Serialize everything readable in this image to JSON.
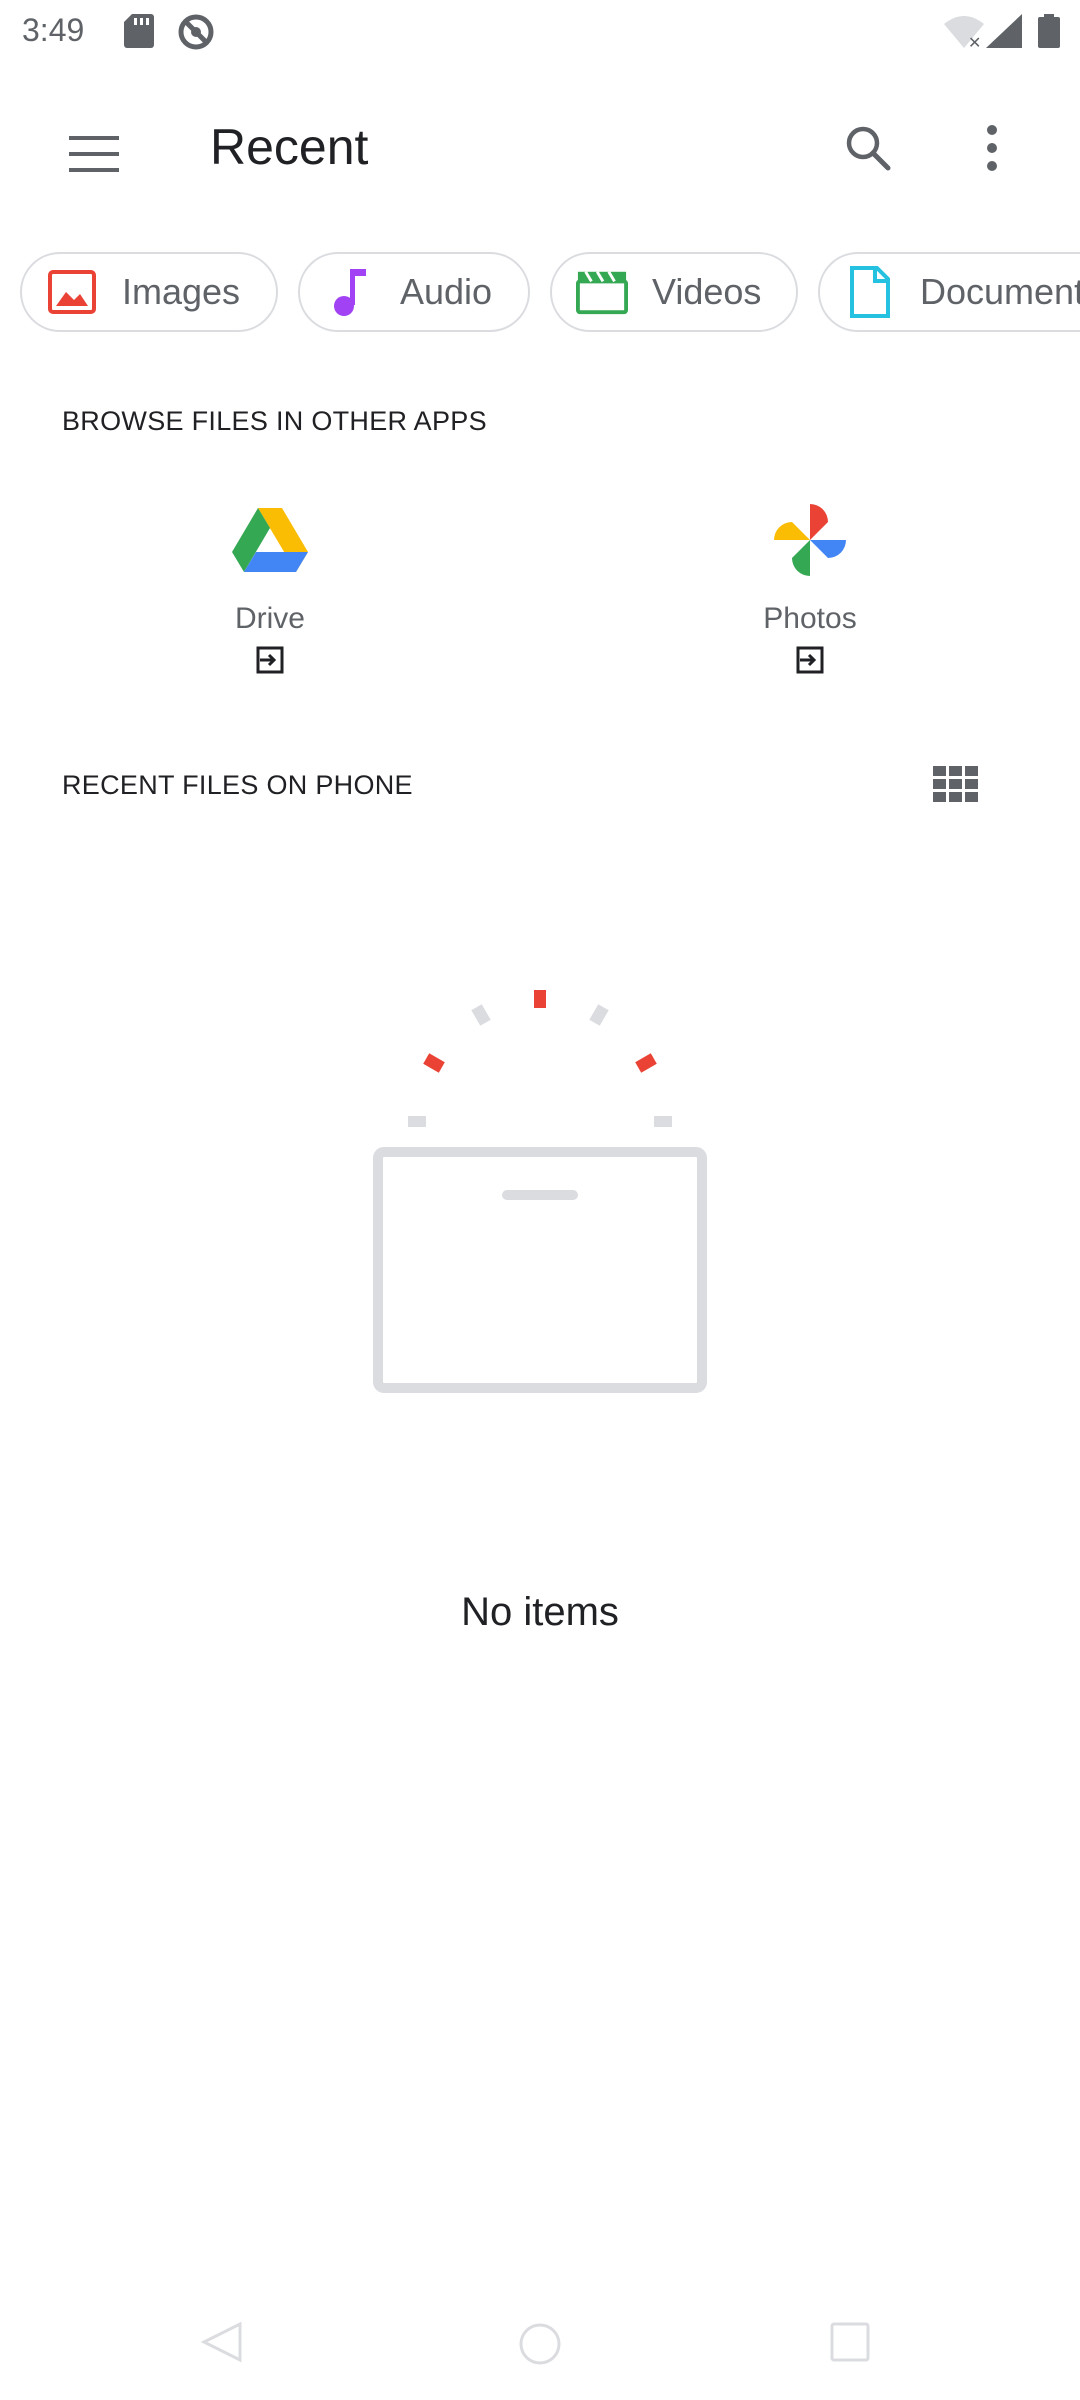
{
  "status_bar": {
    "time": "3:49"
  },
  "app_bar": {
    "title": "Recent"
  },
  "chips": [
    {
      "label": "Images",
      "icon": "image-icon",
      "color": "#ea4335"
    },
    {
      "label": "Audio",
      "icon": "music-note-icon",
      "color": "#a142f4"
    },
    {
      "label": "Videos",
      "icon": "film-clapper-icon",
      "color": "#34a853"
    },
    {
      "label": "Documents",
      "icon": "document-icon",
      "color": "#24c1e0"
    }
  ],
  "browse_section": {
    "header": "BROWSE FILES IN OTHER APPS",
    "apps": [
      {
        "name": "Drive",
        "icon": "google-drive-logo"
      },
      {
        "name": "Photos",
        "icon": "google-photos-logo"
      }
    ]
  },
  "recent_section": {
    "header": "RECENT FILES ON PHONE",
    "view_toggle_icon": "grid-view-icon"
  },
  "empty_state": {
    "message": "No items"
  },
  "colors": {
    "accent_red": "#ea4335",
    "muted_gray": "#dadce0",
    "text_primary": "#202124",
    "text_secondary": "#5f6368"
  }
}
